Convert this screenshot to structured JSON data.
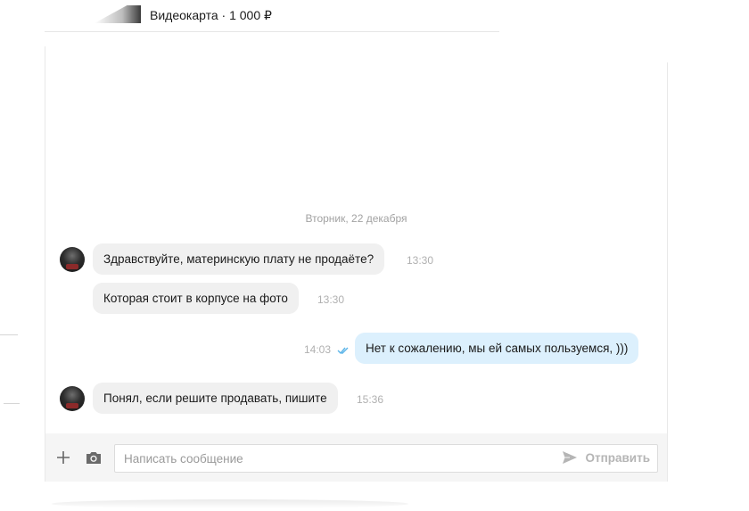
{
  "listing": {
    "title": "Видеокарта · 1 000 ₽"
  },
  "chat": {
    "date_separator": "Вторник, 22 декабря",
    "messages": [
      {
        "direction": "incoming",
        "text": "Здравствуйте, материнскую плату не продаёте?",
        "time": "13:30"
      },
      {
        "direction": "incoming",
        "text": "Которая стоит в корпусе на фото",
        "time": "13:30"
      },
      {
        "direction": "outgoing",
        "text": "Нет к сожалению, мы ей самых пользуемся, )))",
        "time": "14:03",
        "status": "read"
      },
      {
        "direction": "incoming",
        "text": "Понял, если решите продавать, пишите",
        "time": "15:36"
      }
    ]
  },
  "composer": {
    "placeholder": "Написать сообщение",
    "value": "",
    "send_label": "Отправить"
  },
  "colors": {
    "incoming_bubble": "#f0f0f0",
    "outgoing_bubble": "#dcf0fd",
    "read_check": "#5ab4e8"
  },
  "icons": [
    "plus-icon",
    "camera-icon",
    "send-icon",
    "double-check-icon",
    "avatar"
  ]
}
